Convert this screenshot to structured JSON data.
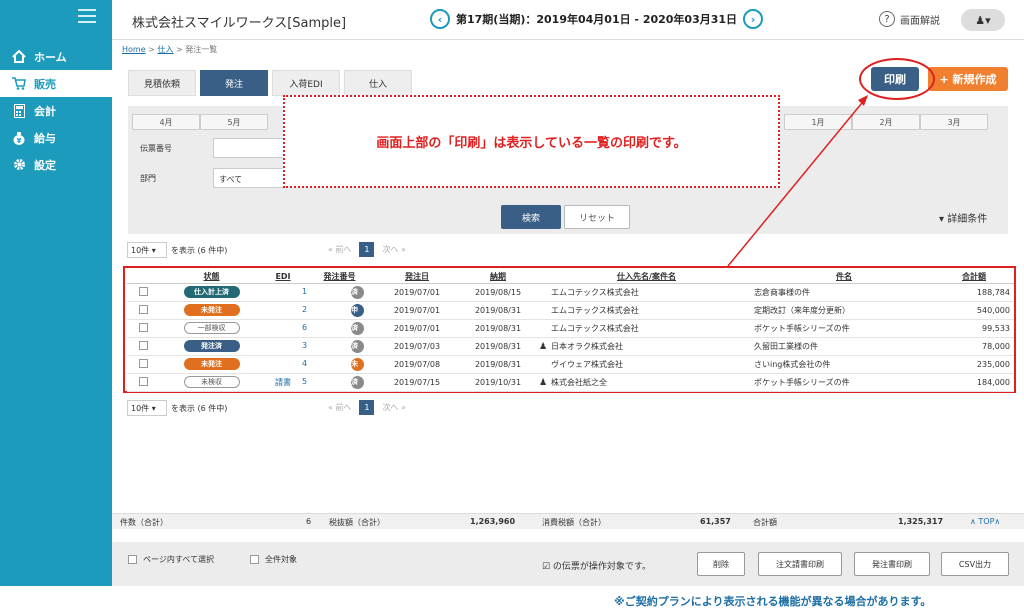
{
  "header": {
    "company": "株式会社スマイルワークス[Sample]",
    "period": "第17期(当期)：2019年04月01日 - 2020年03月31日",
    "help": "画面解説"
  },
  "sidebar": {
    "items": [
      {
        "label": "ホーム",
        "icon": "home-icon"
      },
      {
        "label": "販売",
        "icon": "cart-icon"
      },
      {
        "label": "会計",
        "icon": "calculator-icon"
      },
      {
        "label": "給与",
        "icon": "money-bag-icon"
      },
      {
        "label": "設定",
        "icon": "gear-icon"
      }
    ]
  },
  "breadcrumb": {
    "home": "Home",
    "sep1": " > ",
    "purchase": "仕入",
    "sep2": " > ",
    "current": "発注一覧"
  },
  "tabs": [
    "見積依頼",
    "発注",
    "入荷EDI",
    "仕入"
  ],
  "actions": {
    "print": "印刷",
    "new": "+ 新規作成"
  },
  "filter": {
    "months_left": [
      "4月",
      "5月"
    ],
    "months_right": [
      "1月",
      "2月",
      "3月"
    ],
    "label_slip": "伝票番号",
    "label_dept": "部門",
    "dept_value": "すべて",
    "search": "検索",
    "reset": "リセット",
    "detail": "▾ 詳細条件"
  },
  "callout": "画面上部の「印刷」は表示している一覧の印刷です。",
  "list": {
    "per_page": "10件",
    "showing": "を表示 (6 件中)",
    "prev": "« 前へ",
    "page": "1",
    "next": "次へ »",
    "headers": [
      "状態",
      "EDI",
      "発注番号",
      "発注日",
      "納期",
      "仕入先名/案件名",
      "件名",
      "合計額"
    ],
    "rows": [
      {
        "status": "仕入計上済",
        "status_style": "teal",
        "edi": "",
        "no": "1",
        "badge": "済",
        "badge_style": "gray",
        "date": "2019/07/01",
        "due": "2019/08/15",
        "supplier": "エムコテックス株式会社",
        "person": false,
        "subject": "志倉商事様の件",
        "total": "188,784"
      },
      {
        "status": "未発注",
        "status_style": "orange",
        "edi": "",
        "no": "2",
        "badge": "申",
        "badge_style": "navy",
        "date": "2019/07/01",
        "due": "2019/08/31",
        "supplier": "エムコテックス株式会社",
        "person": false,
        "subject": "定期改訂（来年度分更新）",
        "total": "540,000"
      },
      {
        "status": "一部検収",
        "status_style": "outline",
        "edi": "",
        "no": "6",
        "badge": "済",
        "badge_style": "gray",
        "date": "2019/07/01",
        "due": "2019/08/31",
        "supplier": "エムコテックス株式会社",
        "person": false,
        "subject": "ポケット手帳シリーズの件",
        "total": "99,533"
      },
      {
        "status": "発注済",
        "status_style": "blue",
        "edi": "",
        "no": "3",
        "badge": "済",
        "badge_style": "gray",
        "date": "2019/07/03",
        "due": "2019/08/31",
        "supplier": "日本オラク株式会社",
        "person": true,
        "subject": "久留田工業様の件",
        "total": "78,000"
      },
      {
        "status": "未発注",
        "status_style": "orange",
        "edi": "",
        "no": "4",
        "badge": "未",
        "badge_style": "orange",
        "date": "2019/07/08",
        "due": "2019/08/31",
        "supplier": "ヴイウェア株式会社",
        "person": false,
        "subject": "さいing株式会社の件",
        "total": "235,000"
      },
      {
        "status": "未検収",
        "status_style": "outline",
        "edi": "請書",
        "no": "5",
        "badge": "済",
        "badge_style": "gray",
        "date": "2019/07/15",
        "due": "2019/10/31",
        "supplier": "株式会社紙之全",
        "person": true,
        "subject": "ポケット手帳シリーズの件",
        "total": "184,000"
      }
    ]
  },
  "totals": {
    "count_label": "件数（合計）",
    "count": "6",
    "pretax_label": "税抜額（合計）",
    "pretax": "1,263,960",
    "tax_label": "消費税額（合計）",
    "tax": "61,357",
    "total_label": "合計額",
    "total": "1,325,317",
    "top": "∧ TOP∧"
  },
  "footer": {
    "select_page": "ページ内すべて選択",
    "select_all": "全件対象",
    "target_text": "☑ の伝票が操作対象です。",
    "delete": "削除",
    "order_request_print": "注文請書印刷",
    "order_print": "発注書印刷",
    "csv": "CSV出力"
  },
  "notice": "※ご契約プランにより表示される機能が異なる場合があります。",
  "colors": {
    "sidebar": "#1d9bbd",
    "navy": "#3a5f86",
    "orange": "#f08030",
    "annotation": "#e02020"
  }
}
